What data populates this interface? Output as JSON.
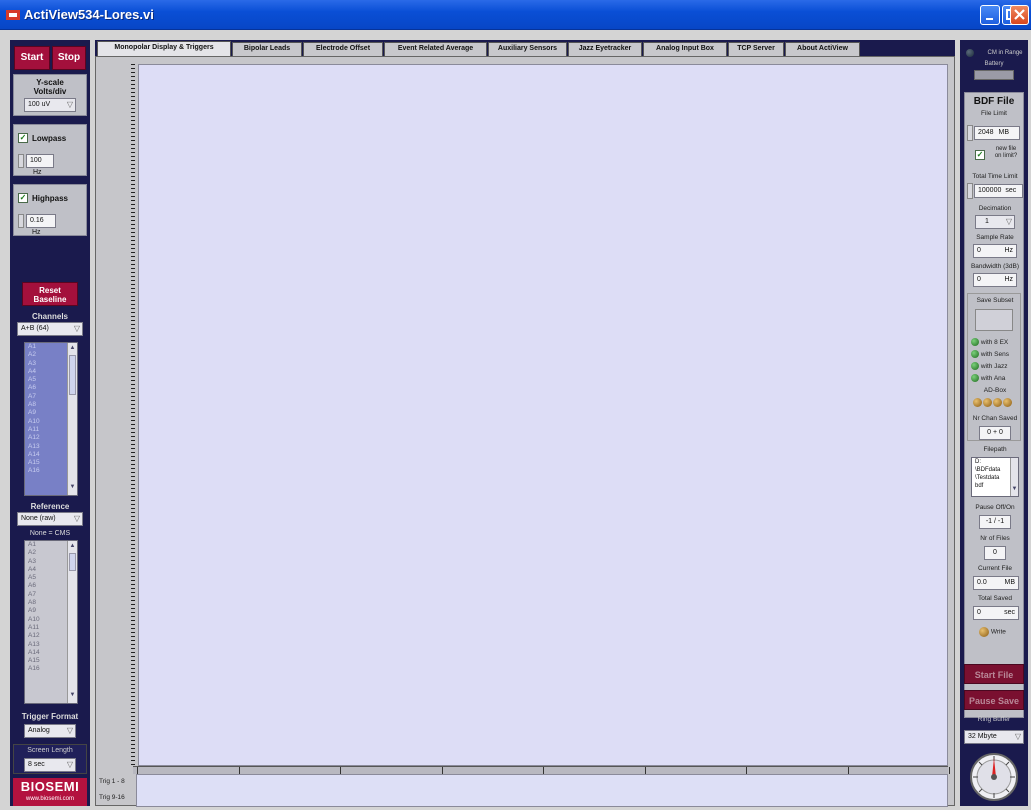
{
  "window": {
    "title": "ActiView534-Lores.vi"
  },
  "left": {
    "start": "Start",
    "stop": "Stop",
    "yscale_label": "Y-scale",
    "yscale_label2": "Volts/div",
    "yscale_value": "100 uV",
    "lowpass_label": "Lowpass",
    "lowpass_value": "100",
    "lowpass_unit": "Hz",
    "highpass_label": "Highpass",
    "highpass_value": "0.16",
    "highpass_unit": "Hz",
    "reset_line1": "Reset",
    "reset_line2": "Baseline",
    "channels_label": "Channels",
    "channels_value": "A+B (64)",
    "channel_list": [
      "A1",
      "A2",
      "A3",
      "A4",
      "A5",
      "A6",
      "A7",
      "A8",
      "A9",
      "A10",
      "A11",
      "A12",
      "A13",
      "A14",
      "A15",
      "A16"
    ],
    "reference_label": "Reference",
    "reference_value": "None (raw)",
    "reference_sub": "None = CMS",
    "reference_list": [
      "A1",
      "A2",
      "A3",
      "A4",
      "A5",
      "A6",
      "A7",
      "A8",
      "A9",
      "A10",
      "A11",
      "A12",
      "A13",
      "A14",
      "A15",
      "A16"
    ],
    "trigger_label": "Trigger Format",
    "trigger_value": "Analog",
    "screen_label": "Screen Length",
    "screen_value": "8 sec",
    "logo": "BIOSEMI",
    "logo_url": "www.biosemi.com"
  },
  "tabs": [
    "Monopolar Display & Triggers",
    "Bipolar Leads",
    "Electrode Offset",
    "Event Related Average",
    "Auxiliary Sensors",
    "Jazz Eyetracker",
    "Analog Input Box",
    "TCP Server",
    "About ActiView"
  ],
  "plot": {
    "trig_1": "Trig 1 - 8",
    "trig_2": "Trig 9-16"
  },
  "right": {
    "cm_range": "CM in Range",
    "battery": "Battery",
    "bdf_title": "BDF File",
    "file_limit_label": "File Limit",
    "file_limit_value": "2048",
    "file_limit_unit": "MB",
    "new_file_label": "new file",
    "new_file_label2": "on limit?",
    "total_time_label": "Total Time Limit",
    "total_time_value": "100000",
    "total_time_unit": "sec",
    "decimation_label": "Decimation",
    "decimation_value": "1",
    "sample_rate_label": "Sample Rate",
    "sample_rate_value": "0",
    "sample_rate_unit": "Hz",
    "bandwidth_label": "Bandwidth (3dB)",
    "bandwidth_value": "0",
    "bandwidth_unit": "Hz",
    "save_subset_label": "Save Subset",
    "with_8ex": "with 8 EX",
    "with_sens": "with Sens",
    "with_jazz": "with Jazz",
    "with_ana": "with Ana",
    "adbox_label": "AD-Box",
    "nr_chan_label": "Nr Chan Saved",
    "nr_chan_value": "0 + 0",
    "filepath_label": "Filepath",
    "filepath_lines": [
      "D:",
      "\\BDFdata",
      "\\Testdata",
      "bdf"
    ],
    "pause_label": "Pause Off/On",
    "pause_value": "-1 / -1",
    "nr_files_label": "Nr of Files",
    "nr_files_value": "0",
    "current_file_label": "Current File",
    "current_file_value": "0.0",
    "current_file_unit": "MB",
    "total_saved_label": "Total Saved",
    "total_saved_value": "0",
    "total_saved_unit": "sec",
    "write_label": "Write",
    "start_file": "Start File",
    "pause_save": "Pause Save",
    "ring_buffer_label": "Ring Buffer",
    "ring_buffer_value": "32 Mbyte"
  }
}
